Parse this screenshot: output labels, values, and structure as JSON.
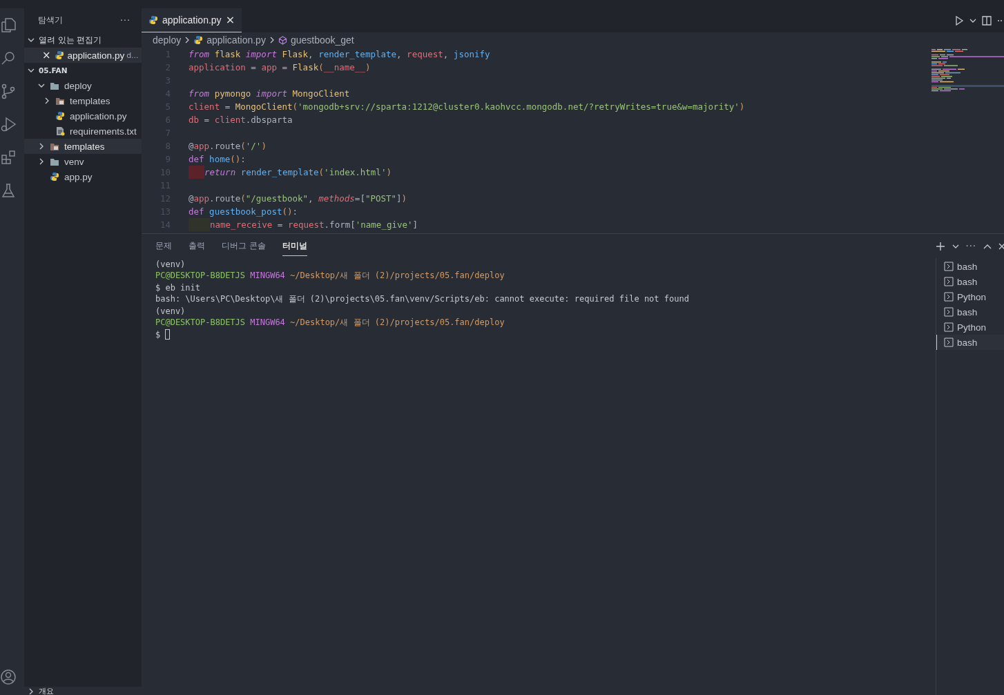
{
  "sidebar": {
    "title": "탐색기",
    "more": "···",
    "open_editors": {
      "label": "열려 있는 편집기",
      "expanded": true,
      "items": [
        {
          "close": "×",
          "name": "application.py",
          "hint": "d...",
          "selected": true
        }
      ]
    },
    "folder": {
      "label": "05.FAN",
      "expanded": true,
      "tree": [
        {
          "name": "deploy",
          "kind": "folder",
          "expanded": true,
          "selected": false,
          "children": [
            {
              "name": "templates",
              "kind": "templates",
              "expanded": false,
              "selected": false
            },
            {
              "name": "application.py",
              "kind": "python",
              "selected": false
            },
            {
              "name": "requirements.txt",
              "kind": "text",
              "selected": false
            }
          ]
        },
        {
          "name": "templates",
          "kind": "templates",
          "expanded": false,
          "selected": true
        },
        {
          "name": "venv",
          "kind": "folder",
          "expanded": false,
          "selected": false
        },
        {
          "name": "app.py",
          "kind": "python",
          "selected": false
        }
      ]
    },
    "outline": {
      "label": "개요",
      "expanded": false
    }
  },
  "editor": {
    "tabs": [
      {
        "name": "application.py",
        "close": "×",
        "selected": true
      }
    ],
    "breadcrumb": [
      "deploy",
      "application.py",
      "guestbook_get"
    ],
    "lines": [
      {
        "n": "1",
        "tokens": [
          {
            "kind": "kw",
            "t": "from"
          },
          {
            "kind": "mod",
            "t": " flask"
          },
          {
            "kind": "kw",
            "t": " import"
          },
          {
            "kind": "mod",
            "t": " Flask"
          },
          {
            "kind": "plain",
            "t": ","
          },
          {
            "kind": "fn",
            "t": " render_template"
          },
          {
            "kind": "plain",
            "t": ","
          },
          {
            "kind": "var",
            "t": " request"
          },
          {
            "kind": "plain",
            "t": ","
          },
          {
            "kind": "fn",
            "t": " jsonify"
          }
        ]
      },
      {
        "n": "2",
        "tokens": [
          {
            "kind": "var",
            "t": "application"
          },
          {
            "kind": "plain",
            "t": " ="
          },
          {
            "kind": "var",
            "t": " app"
          },
          {
            "kind": "plain",
            "t": " ="
          },
          {
            "kind": "mod",
            "t": " Flask"
          },
          {
            "kind": "paren",
            "t": "("
          },
          {
            "kind": "var",
            "t": "__name__"
          },
          {
            "kind": "paren",
            "t": ")"
          }
        ]
      },
      {
        "n": "3"
      },
      {
        "n": "4",
        "tokens": [
          {
            "kind": "kw",
            "t": "from"
          },
          {
            "kind": "mod",
            "t": " pymongo"
          },
          {
            "kind": "kw",
            "t": " import"
          },
          {
            "kind": "mod",
            "t": " MongoClient"
          }
        ]
      },
      {
        "n": "5",
        "tokens": [
          {
            "kind": "var",
            "t": "client"
          },
          {
            "kind": "plain",
            "t": " ="
          },
          {
            "kind": "mod",
            "t": " MongoClient"
          },
          {
            "kind": "paren",
            "t": "("
          },
          {
            "kind": "str",
            "t": "'mongodb+srv://sparta:1212@cluster0.kaohvcc.mongodb.net/?retryWrites=true&w=majority'"
          },
          {
            "kind": "paren",
            "t": ")"
          }
        ]
      },
      {
        "n": "6",
        "tokens": [
          {
            "kind": "var",
            "t": "db"
          },
          {
            "kind": "plain",
            "t": " ="
          },
          {
            "kind": "var",
            "t": " client"
          },
          {
            "kind": "plain",
            "t": ".dbsparta"
          }
        ]
      },
      {
        "n": "7"
      },
      {
        "n": "8",
        "tokens": [
          {
            "kind": "plain",
            "t": "@"
          },
          {
            "kind": "var",
            "t": "app"
          },
          {
            "kind": "plain",
            "t": ".route"
          },
          {
            "kind": "paren",
            "t": "("
          },
          {
            "kind": "str",
            "t": "'/'"
          },
          {
            "kind": "paren",
            "t": ")"
          }
        ]
      },
      {
        "n": "9",
        "tokens": [
          {
            "kind": "def",
            "t": "def"
          },
          {
            "kind": "fn",
            "t": " home"
          },
          {
            "kind": "paren",
            "t": "()"
          },
          {
            "kind": "plain",
            "t": ":"
          }
        ]
      },
      {
        "n": "10",
        "indent_error": true,
        "tokens": [
          {
            "kind": "kw",
            "t": "return"
          },
          {
            "kind": "fn",
            "t": " render_template"
          },
          {
            "kind": "paren",
            "t": "("
          },
          {
            "kind": "str",
            "t": "'index.html'"
          },
          {
            "kind": "paren",
            "t": ")"
          }
        ]
      },
      {
        "n": "11"
      },
      {
        "n": "12",
        "tokens": [
          {
            "kind": "plain",
            "t": "@"
          },
          {
            "kind": "var",
            "t": "app"
          },
          {
            "kind": "plain",
            "t": ".route"
          },
          {
            "kind": "paren",
            "t": "("
          },
          {
            "kind": "str",
            "t": "\"/guestbook\""
          },
          {
            "kind": "plain",
            "t": ","
          },
          {
            "kind": "param",
            "t": " methods"
          },
          {
            "kind": "plain",
            "t": "=["
          },
          {
            "kind": "str",
            "t": "\"POST\""
          },
          {
            "kind": "plain",
            "t": "]"
          },
          {
            "kind": "paren",
            "t": ")"
          }
        ]
      },
      {
        "n": "13",
        "tokens": [
          {
            "kind": "def",
            "t": "def"
          },
          {
            "kind": "fn",
            "t": " guestbook_post"
          },
          {
            "kind": "paren",
            "t": "()"
          },
          {
            "kind": "plain",
            "t": ":"
          }
        ]
      },
      {
        "n": "14",
        "indent_warning": true,
        "tokens": [
          {
            "kind": "var",
            "t": "name_receive"
          },
          {
            "kind": "plain",
            "t": " ="
          },
          {
            "kind": "var",
            "t": " request"
          },
          {
            "kind": "plain",
            "t": ".form["
          },
          {
            "kind": "str",
            "t": "'name_give'"
          },
          {
            "kind": "plain",
            "t": "]"
          }
        ]
      }
    ]
  },
  "panel": {
    "tabs": [
      {
        "label": "문제",
        "selected": false
      },
      {
        "label": "출력",
        "selected": false
      },
      {
        "label": "디버그 콘솔",
        "selected": false
      },
      {
        "label": "터미널",
        "selected": true
      }
    ],
    "terminal": [
      [
        {
          "kind": "plain",
          "t": "(venv)"
        }
      ],
      [
        {
          "kind": "user",
          "t": "PC@DESKTOP-B8DETJS"
        },
        {
          "kind": "host",
          "t": " MINGW64"
        },
        {
          "kind": "path",
          "t": " ~/Desktop/새 폴더 (2)/projects/05.fan/deploy"
        }
      ],
      [
        {
          "kind": "plain",
          "t": "$ eb init"
        }
      ],
      [
        {
          "kind": "plain",
          "t": "bash: \\Users\\PC\\Desktop\\새 폴더 (2)\\projects\\05.fan\\venv/Scripts/eb: cannot execute: required file not found"
        }
      ],
      [
        {
          "kind": "plain",
          "t": "(venv)"
        }
      ],
      [
        {
          "kind": "user",
          "t": "PC@DESKTOP-B8DETJS"
        },
        {
          "kind": "host",
          "t": " MINGW64"
        },
        {
          "kind": "path",
          "t": " ~/Desktop/새 폴더 (2)/projects/05.fan/deploy"
        }
      ],
      [
        {
          "kind": "plain",
          "t": "$"
        },
        {
          "kind": "cursor"
        }
      ]
    ],
    "terminals": [
      {
        "name": "bash",
        "selected": false
      },
      {
        "name": "bash",
        "selected": false
      },
      {
        "name": "Python",
        "selected": false
      },
      {
        "name": "bash",
        "selected": false
      },
      {
        "name": "Python",
        "selected": false
      },
      {
        "name": "bash",
        "selected": true
      }
    ],
    "more": "···"
  }
}
